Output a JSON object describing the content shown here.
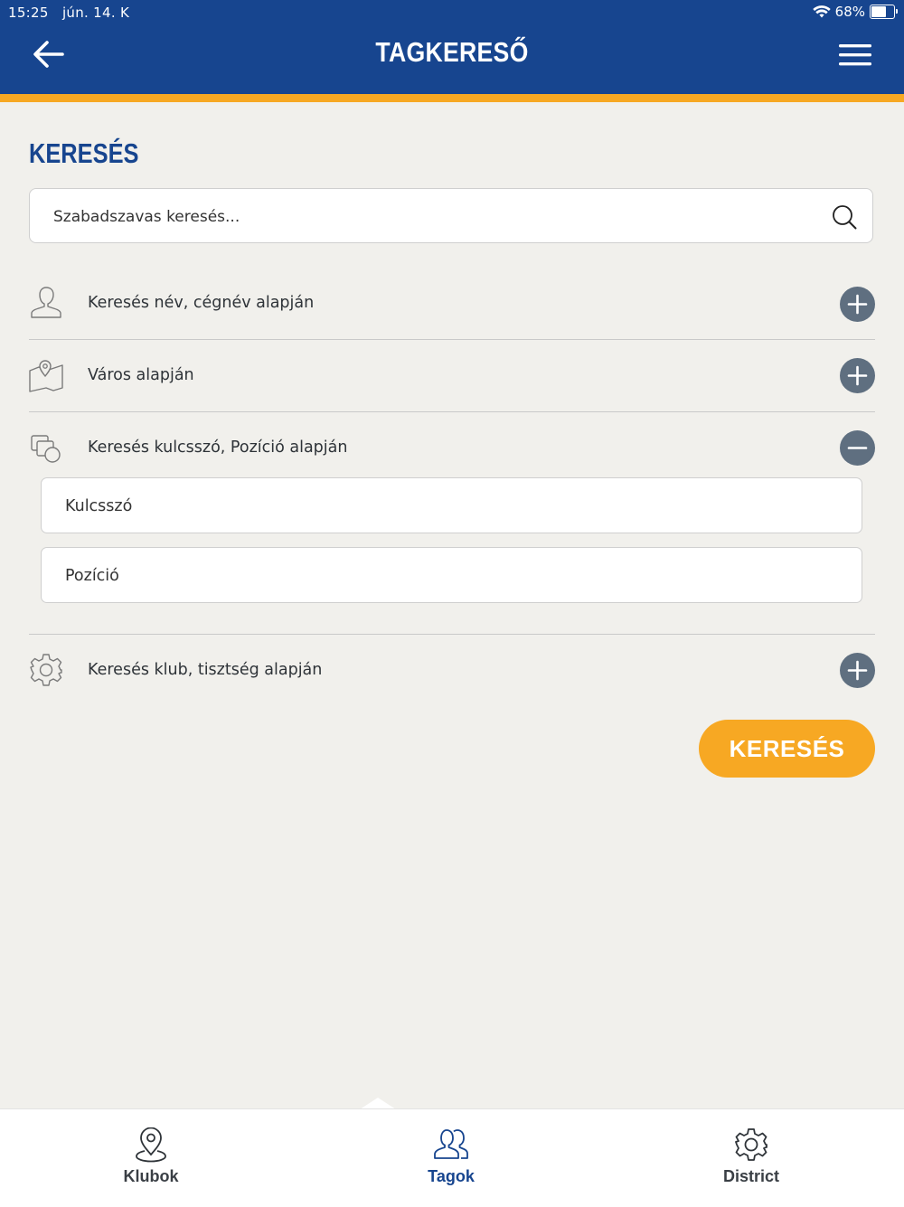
{
  "status_bar": {
    "time": "15:25",
    "date": "jún. 14. K",
    "battery": "68%"
  },
  "header": {
    "title": "TAGKERESŐ",
    "back_icon": "arrow-left-icon",
    "menu_icon": "hamburger-menu-icon"
  },
  "colors": {
    "header_bg": "#17458f",
    "accent": "#f7a823",
    "toggle": "#5f6f80",
    "background": "#f1f0ec"
  },
  "search": {
    "title": "KERESÉS",
    "placeholder": "Szabadszavas keresés...",
    "icon": "search-icon"
  },
  "filters": [
    {
      "label": "Keresés név, cégnév alapján",
      "icon": "person-icon",
      "expanded": false
    },
    {
      "label": "Város alapján",
      "icon": "map-pin-icon",
      "expanded": false
    },
    {
      "label": "Keresés kulcsszó, Pozíció alapján",
      "icon": "shapes-icon",
      "expanded": true,
      "fields": [
        {
          "placeholder": "Kulcsszó"
        },
        {
          "placeholder": "Pozíció"
        }
      ]
    },
    {
      "label": "Keresés klub, tisztség alapján",
      "icon": "gear-icon",
      "expanded": false
    }
  ],
  "submit_label": "KERESÉS",
  "tabs": [
    {
      "label": "Klubok",
      "icon": "location-pin-icon",
      "active": false
    },
    {
      "label": "Tagok",
      "icon": "people-icon",
      "active": true
    },
    {
      "label": "District",
      "icon": "gear-icon",
      "active": false
    }
  ]
}
